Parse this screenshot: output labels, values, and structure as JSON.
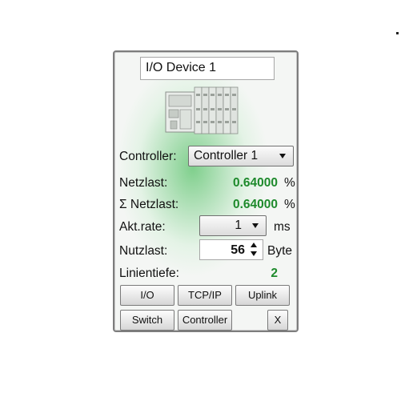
{
  "device": {
    "name": "I/O Device 1"
  },
  "controller": {
    "label": "Controller:",
    "selected": "Controller 1"
  },
  "netzlast": {
    "label": "Netzlast:",
    "value": "0.64000",
    "unit": "%"
  },
  "sum_netzlast": {
    "label": "Σ Netzlast:",
    "value": "0.64000",
    "unit": "%"
  },
  "akt_rate": {
    "label": "Akt.rate:",
    "selected": "1",
    "unit": "ms"
  },
  "nutzlast": {
    "label": "Nutzlast:",
    "value": "56",
    "unit": "Byte"
  },
  "linientiefe": {
    "label": "Linientiefe:",
    "value": "2"
  },
  "buttons": {
    "io": "I/O",
    "tcpip": "TCP/IP",
    "uplink": "Uplink",
    "switch": "Switch",
    "controller": "Controller",
    "close": "X"
  },
  "colors": {
    "value_green": "#1e8a2c",
    "panel_border": "#7d7d7d",
    "glow_green": "#7fcf8c"
  },
  "icons": {
    "device": "io-device-icon",
    "dropdown": "chevron-down-icon",
    "stepper_up": "arrow-up-icon",
    "stepper_down": "arrow-down-icon"
  }
}
